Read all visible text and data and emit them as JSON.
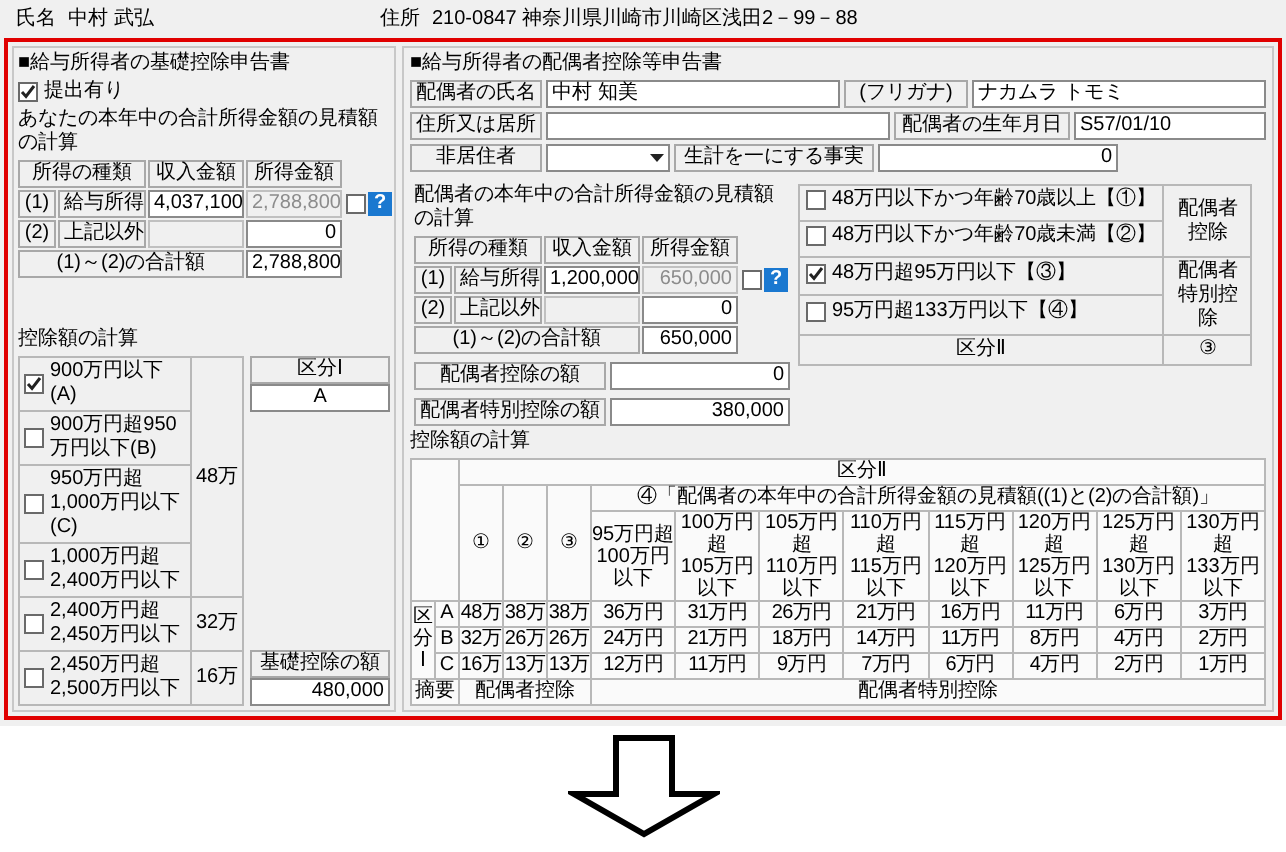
{
  "header": {
    "name_label": "氏名",
    "name": "中村 武弘",
    "address_label": "住所",
    "address": "210-0847 神奈川県川崎市川崎区浅田2－99－88"
  },
  "basic": {
    "title": "■給与所得者の基礎控除申告書",
    "submitted": {
      "label": "提出有り",
      "checked": true
    },
    "income_title": "あなたの本年中の合計所得金額の見積額の計算",
    "income": {
      "columns": [
        "所得の種類",
        "収入金額",
        "所得金額"
      ],
      "rows": [
        {
          "no": "(1)",
          "type": "給与所得",
          "revenue": {
            "value": "4,037,100",
            "readonly": false
          },
          "income": {
            "value": "2,788,800",
            "readonly": true
          },
          "checked": false,
          "help": "?"
        },
        {
          "no": "(2)",
          "type": "上記以外",
          "revenue": {
            "readonly": true
          },
          "income": {
            "value": "0",
            "readonly": false
          }
        }
      ],
      "total": {
        "label": "(1)～(2)の合計額",
        "value": "2,788,800",
        "readonly": false
      }
    },
    "deduction_title": "控除額の計算",
    "brackets": [
      {
        "amount": "48万",
        "options": [
          {
            "label": "900万円以下(A)",
            "checked": true
          },
          {
            "label": "900万円超950万円以下(B)",
            "checked": false
          },
          {
            "label": "950万円超1,000万円以下(C)",
            "checked": false
          },
          {
            "label": "1,000万円超2,400万円以下",
            "checked": false
          }
        ]
      },
      {
        "amount": "32万",
        "options": [
          {
            "label": "2,400万円超2,450万円以下",
            "checked": false
          }
        ]
      },
      {
        "amount": "16万",
        "options": [
          {
            "label": "2,450万円超2,500万円以下",
            "checked": false
          }
        ]
      }
    ],
    "category": {
      "label": "区分Ⅰ",
      "value": "A"
    },
    "basic_deduction": {
      "label": "基礎控除の額",
      "value": "480,000",
      "readonly": false
    }
  },
  "spouse": {
    "title": "■給与所得者の配偶者控除等申告書",
    "name_label": "配偶者の氏名",
    "name": "中村 知美",
    "kana_label": "(フリガナ)",
    "kana": "ナカムラ トモミ",
    "address_label": "住所又は居所",
    "birth_label": "配偶者の生年月日",
    "birth": "S57/01/10",
    "nonresident_label": "非居住者",
    "livelihood_label": "生計を一にする事実",
    "livelihood": "0",
    "income_title": "配偶者の本年中の合計所得金額の見積額の計算",
    "income": {
      "columns": [
        "所得の種類",
        "収入金額",
        "所得金額"
      ],
      "rows": [
        {
          "no": "(1)",
          "type": "給与所得",
          "revenue": {
            "value": "1,200,000",
            "readonly": false
          },
          "income": {
            "value": "650,000",
            "readonly": true
          },
          "checked": false,
          "help": "?"
        },
        {
          "no": "(2)",
          "type": "上記以外",
          "revenue": {
            "readonly": true
          },
          "income": {
            "value": "0",
            "readonly": false
          }
        }
      ],
      "total": {
        "label": "(1)～(2)の合計額",
        "value": "650,000",
        "readonly": false
      }
    },
    "groups": [
      {
        "label": "配偶者控除",
        "options": [
          {
            "label": "48万円以下かつ年齢70歳以上【①】",
            "checked": false
          },
          {
            "label": "48万円以下かつ年齢70歳未満【②】",
            "checked": false
          }
        ]
      },
      {
        "label": "配偶者特別控除",
        "options": [
          {
            "label": "48万円超95万円以下【③】",
            "checked": true
          },
          {
            "label": "95万円超133万円以下【④】",
            "checked": false
          }
        ]
      }
    ],
    "category": {
      "label": "区分Ⅱ",
      "value": "③"
    },
    "results": [
      {
        "label": "配偶者控除の額",
        "value": "0",
        "readonly": false
      },
      {
        "label": "配偶者特別控除の額",
        "value": "380,000",
        "readonly": false
      }
    ],
    "table_title": "控除額の計算",
    "table": {
      "header": "区分Ⅱ",
      "sub_columns": [
        "①",
        "②",
        "③"
      ],
      "range_header": "④「配偶者の本年中の合計所得金額の見積額((1)と(2)の合計額)」",
      "ranges": [
        {
          "from": "95万円超",
          "to": "100万円以下"
        },
        {
          "from": "100万円超",
          "to": "105万円以下"
        },
        {
          "from": "105万円超",
          "to": "110万円以下"
        },
        {
          "from": "110万円超",
          "to": "115万円以下"
        },
        {
          "from": "115万円超",
          "to": "120万円以下"
        },
        {
          "from": "120万円超",
          "to": "125万円以下"
        },
        {
          "from": "125万円超",
          "to": "130万円以下"
        },
        {
          "from": "130万円超",
          "to": "133万円以下"
        }
      ],
      "row_group_label": "区分Ⅰ",
      "rows": [
        {
          "key": "A",
          "values": [
            "48万",
            "38万",
            "38万",
            "36万円",
            "31万円",
            "26万円",
            "21万円",
            "16万円",
            "11万円",
            "6万円",
            "3万円"
          ]
        },
        {
          "key": "B",
          "values": [
            "32万",
            "26万",
            "26万",
            "24万円",
            "21万円",
            "18万円",
            "14万円",
            "11万円",
            "8万円",
            "4万円",
            "2万円"
          ]
        },
        {
          "key": "C",
          "values": [
            "16万",
            "13万",
            "13万",
            "12万円",
            "11万円",
            "9万円",
            "7万円",
            "6万円",
            "4万円",
            "2万円",
            "1万円"
          ]
        }
      ],
      "footer": [
        "摘要",
        "配偶者控除",
        "配偶者特別控除"
      ]
    }
  }
}
